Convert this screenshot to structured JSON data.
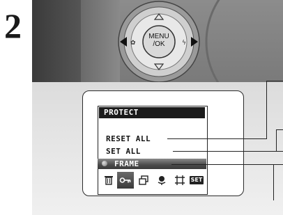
{
  "step_number": "2",
  "dpad": {
    "center_label_line1": "MENU",
    "center_label_line2": "/OK"
  },
  "menu": {
    "title": "PROTECT",
    "items": [
      {
        "label": "RESET ALL"
      },
      {
        "label": "SET ALL"
      },
      {
        "label": "FRAME",
        "selected": true
      }
    ]
  },
  "icon_bar": [
    {
      "icon": "trash-icon"
    },
    {
      "icon": "key-icon",
      "selected": true
    },
    {
      "icon": "copy-icon"
    },
    {
      "icon": "microphone-icon"
    },
    {
      "icon": "trim-icon"
    },
    {
      "icon": "set-icon",
      "label": "SET"
    }
  ],
  "colors": {
    "menu_title_bg": "#1b1b1b",
    "selection_bar": "#4a4a4a"
  }
}
